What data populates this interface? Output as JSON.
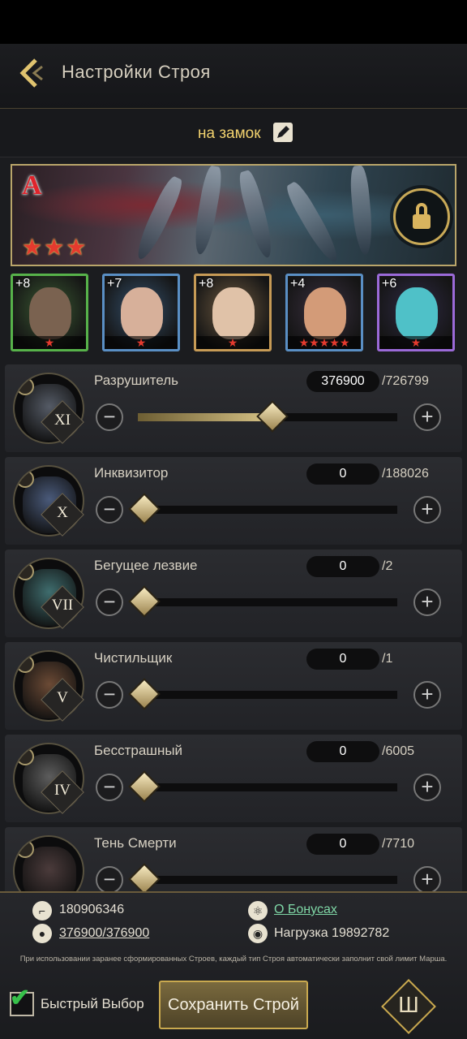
{
  "header": {
    "title": "Настройки Строя"
  },
  "target": {
    "label": "на замок"
  },
  "banner": {
    "grade": "A",
    "stars": "★★★"
  },
  "heroes": [
    {
      "level": "+8",
      "stars": "★",
      "frame": "#57b24a",
      "bg": "#3a5a32",
      "face": "#7a6250"
    },
    {
      "level": "+7",
      "stars": "★",
      "frame": "#5a8fc4",
      "bg": "#34506c",
      "face": "#d7b09a"
    },
    {
      "level": "+8",
      "stars": "★",
      "frame": "#c79b56",
      "bg": "#6e5a40",
      "face": "#e0c2a8"
    },
    {
      "level": "+4",
      "stars": "★★★★★",
      "frame": "#5a8fc4",
      "bg": "#3a3040",
      "face": "#d39b78"
    },
    {
      "level": "+6",
      "stars": "★",
      "frame": "#9b6ad8",
      "bg": "#2f2a45",
      "face": "#4fc1c8"
    }
  ],
  "troops": [
    {
      "name": "Разрушитель",
      "count": "376900",
      "max": "/726799",
      "rank": "XI",
      "fraction": 0.5186,
      "pic": "#555b66"
    },
    {
      "name": "Инквизитор",
      "count": "0",
      "max": "/188026",
      "rank": "X",
      "fraction": 0,
      "pic": "#4a5a7a"
    },
    {
      "name": "Бегущее лезвие",
      "count": "0",
      "max": "/2",
      "rank": "VII",
      "fraction": 0,
      "pic": "#3f6d6e"
    },
    {
      "name": "Чистильщик",
      "count": "0",
      "max": "/1",
      "rank": "V",
      "fraction": 0,
      "pic": "#6b4a35"
    },
    {
      "name": "Бесстрашный",
      "count": "0",
      "max": "/6005",
      "rank": "IV",
      "fraction": 0,
      "pic": "#5d5d5d"
    },
    {
      "name": "Тень Смерти",
      "count": "0",
      "max": "/7710",
      "rank": "",
      "fraction": 0,
      "pic": "#4b3b3b"
    }
  ],
  "stats": {
    "power": "180906346",
    "army_current": "376900",
    "army_separator": "/",
    "army_max": "376900",
    "bonuses_link": "О Бонусах",
    "load": "Нагрузка 19892782"
  },
  "hint": "При использовании заранее сформированных Строев, каждый тип Строя автоматически заполнит свой лимит Марша.",
  "quick_select": {
    "label": "Быстрый Выбор",
    "checked": true
  },
  "save_button": {
    "label": "Сохранить Строй"
  }
}
